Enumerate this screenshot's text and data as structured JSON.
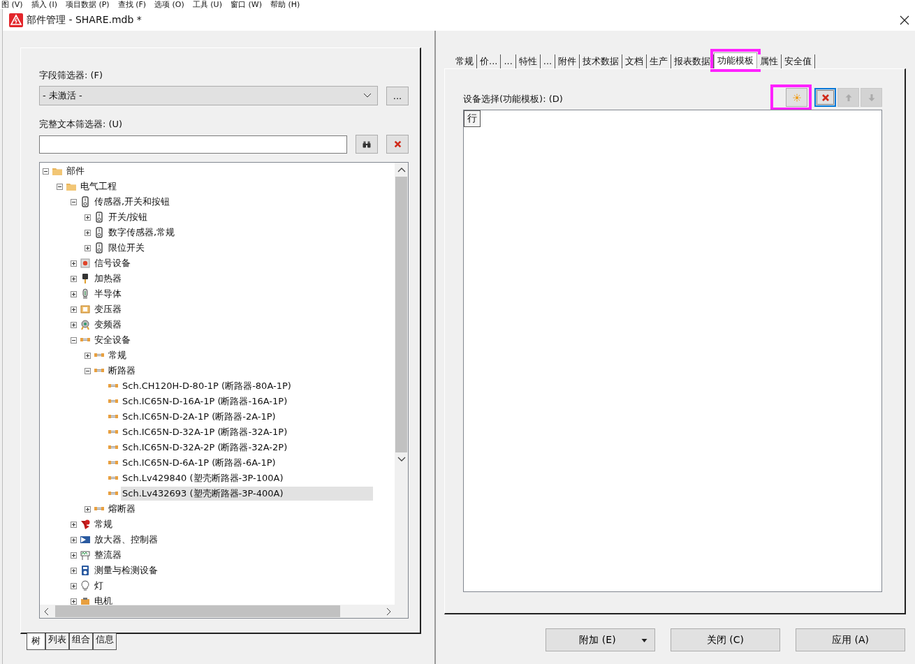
{
  "app_menu": [
    "图 (V)",
    "插入 (I)",
    "项目数据 (P)",
    "查找 (F)",
    "选项 (O)",
    "工具 (U)",
    "窗口 (W)",
    "帮助 (H)"
  ],
  "window": {
    "title": "部件管理 - SHARE.mdb *"
  },
  "left_panel": {
    "field_filter": {
      "label": "字段筛选器: (F)",
      "value": "- 未激活 -",
      "more_button": "..."
    },
    "text_filter": {
      "label": "完整文本筛选器: (U)"
    },
    "tree": [
      {
        "label": "部件",
        "kind": "folder",
        "expanded": true,
        "children": [
          {
            "label": "电气工程",
            "kind": "folder",
            "expanded": true,
            "children": [
              {
                "label": "传感器,开关和按钮",
                "kind": "sensor",
                "expanded": true,
                "children": [
                  {
                    "label": "开关/按钮",
                    "kind": "sensor",
                    "expanded": false
                  },
                  {
                    "label": "数字传感器,常规",
                    "kind": "sensor",
                    "expanded": false
                  },
                  {
                    "label": "限位开关",
                    "kind": "sensor",
                    "expanded": false
                  }
                ]
              },
              {
                "label": "信号设备",
                "kind": "signal",
                "expanded": false
              },
              {
                "label": "加热器",
                "kind": "heater",
                "expanded": false
              },
              {
                "label": "半导体",
                "kind": "semiconductor",
                "expanded": false
              },
              {
                "label": "变压器",
                "kind": "transformer",
                "expanded": false
              },
              {
                "label": "变频器",
                "kind": "inverter",
                "expanded": false
              },
              {
                "label": "安全设备",
                "kind": "fuse",
                "expanded": true,
                "children": [
                  {
                    "label": "常规",
                    "kind": "fuse",
                    "expanded": false
                  },
                  {
                    "label": "断路器",
                    "kind": "fuse",
                    "expanded": true,
                    "children": [
                      {
                        "label": "Sch.CH120H-D-80-1P (断路器-80A-1P)",
                        "kind": "fuse",
                        "selected": false
                      },
                      {
                        "label": "Sch.IC65N-D-16A-1P (断路器-16A-1P)",
                        "kind": "fuse",
                        "selected": false
                      },
                      {
                        "label": "Sch.IC65N-D-2A-1P (断路器-2A-1P)",
                        "kind": "fuse",
                        "selected": false
                      },
                      {
                        "label": "Sch.IC65N-D-32A-1P (断路器-32A-1P)",
                        "kind": "fuse",
                        "selected": false
                      },
                      {
                        "label": "Sch.IC65N-D-32A-2P (断路器-32A-2P)",
                        "kind": "fuse",
                        "selected": false
                      },
                      {
                        "label": "Sch.IC65N-D-6A-1P (断路器-6A-1P)",
                        "kind": "fuse",
                        "selected": false
                      },
                      {
                        "label": "Sch.Lv429840 (塑壳断路器-3P-100A)",
                        "kind": "fuse",
                        "selected": false
                      },
                      {
                        "label": "Sch.Lv432693 (塑壳断路器-3P-400A)",
                        "kind": "fuse",
                        "selected": true
                      }
                    ]
                  },
                  {
                    "label": "熔断器",
                    "kind": "fuse",
                    "expanded": false
                  }
                ]
              },
              {
                "label": "常规",
                "kind": "general",
                "expanded": false
              },
              {
                "label": "放大器、控制器",
                "kind": "amplifier",
                "expanded": false
              },
              {
                "label": "整流器",
                "kind": "rectifier",
                "expanded": false
              },
              {
                "label": "测量与检测设备",
                "kind": "meter",
                "expanded": false
              },
              {
                "label": "灯",
                "kind": "lamp",
                "expanded": false
              },
              {
                "label": "电机",
                "kind": "motor",
                "expanded": false
              }
            ]
          }
        ]
      }
    ],
    "bottom_tabs": [
      {
        "label": "树",
        "selected": true
      },
      {
        "label": "列表",
        "selected": false
      },
      {
        "label": "组合",
        "selected": false
      },
      {
        "label": "信息",
        "selected": false
      }
    ]
  },
  "right_panel": {
    "tabs": [
      {
        "label": "常规",
        "selected": false,
        "highlighted": false
      },
      {
        "label": "价...",
        "selected": false,
        "highlighted": false
      },
      {
        "label": "...",
        "selected": false,
        "highlighted": false
      },
      {
        "label": "特性",
        "selected": false,
        "highlighted": false
      },
      {
        "label": "...",
        "selected": false,
        "highlighted": false
      },
      {
        "label": "附件",
        "selected": false,
        "highlighted": false
      },
      {
        "label": "技术数据",
        "selected": false,
        "highlighted": false
      },
      {
        "label": "文档",
        "selected": false,
        "highlighted": false
      },
      {
        "label": "生产",
        "selected": false,
        "highlighted": false
      },
      {
        "label": "报表数据",
        "selected": false,
        "highlighted": false
      },
      {
        "label": "功能模板",
        "selected": true,
        "highlighted": true
      },
      {
        "label": "属性",
        "selected": false,
        "highlighted": false
      },
      {
        "label": "安全值",
        "selected": false,
        "highlighted": false
      }
    ],
    "device_label": "设备选择(功能模板): (D)",
    "tools": [
      {
        "kind": "new",
        "disabled": false,
        "focused": false,
        "highlighted": true
      },
      {
        "kind": "delete",
        "disabled": false,
        "focused": true,
        "highlighted": false
      },
      {
        "kind": "up",
        "disabled": true,
        "focused": false,
        "highlighted": false
      },
      {
        "kind": "down",
        "disabled": true,
        "focused": false,
        "highlighted": false
      }
    ],
    "grid": {
      "row_header": "行"
    }
  },
  "buttons": [
    {
      "label": "附加 (E)",
      "dropdown": true
    },
    {
      "label": "关闭 (C)",
      "dropdown": false
    },
    {
      "label": "应用 (A)",
      "dropdown": false
    }
  ]
}
